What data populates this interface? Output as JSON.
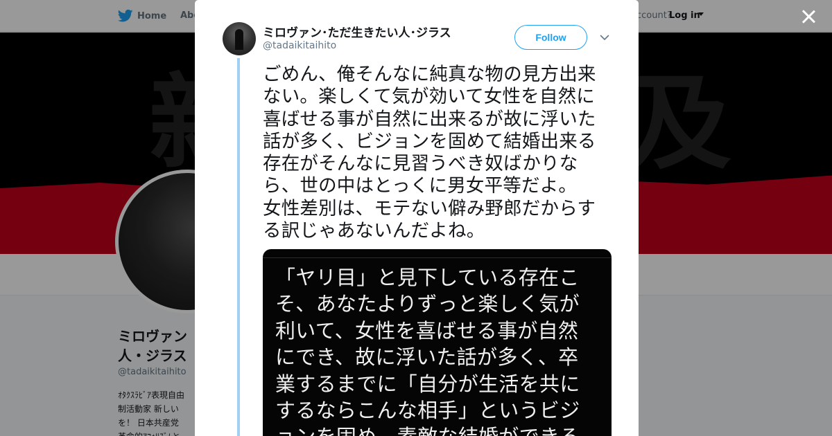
{
  "nav": {
    "home_label": "Home",
    "about_label": "Abo",
    "account_prompt": "ccount?",
    "login_label": "Log in"
  },
  "banner": {
    "char_left": "新",
    "char_right": "及",
    "colors": {
      "black": "#000000",
      "red": "#c4001a"
    }
  },
  "profile": {
    "name": "ミロヴァン・ただ生きたい人・ジラス",
    "name_lines": [
      "ミロヴァン",
      "人・ジラス"
    ],
    "handle": "@tadaikitaihito",
    "bio_lines": [
      "ｵﾀｸｽﾗﾋﾞｱ表現自由",
      "制活動家 新しい",
      "を！ 日本共産党",
      "革命的ｱﾌｫﾘｽﾞﾑと"
    ]
  },
  "tweet": {
    "author_name": "ミロヴァン･ただ生きたい人･ジラス",
    "author_handle": "@tadaikitaihito",
    "follow_label": "Follow",
    "text_lines": [
      "ごめん、俺そんなに純真な物の見方出来",
      "ない。楽しくて気が効いて女性を自然に",
      "喜ばせる事が自然に出来るが故に浮いた",
      "話が多く、ビジョンを固めて結婚出来る",
      "存在がそんなに見習うべき奴ばかりな",
      "ら、世の中はとっくに男女平等だよ。",
      "女性差別は、モテない僻み野郎だからす",
      "る訳じゃあないんだよね。"
    ],
    "media_text_lines": [
      "「ヤリ目」と見下している存在こ",
      "そ、あなたよりずっと楽しく気が",
      "利いて、女性を喜ばせる事が自然",
      "にでき、故に浮いた話が多く、卒",
      "業するまでに「自分が生活を共に",
      "するならこんな相手」というビジ",
      "ョンを固め、素敵な結婚ができる"
    ]
  },
  "colors": {
    "accent": "#1da1f2",
    "thread_line": "#a2d0f3",
    "text_primary": "#14171a",
    "text_secondary": "#657786"
  }
}
